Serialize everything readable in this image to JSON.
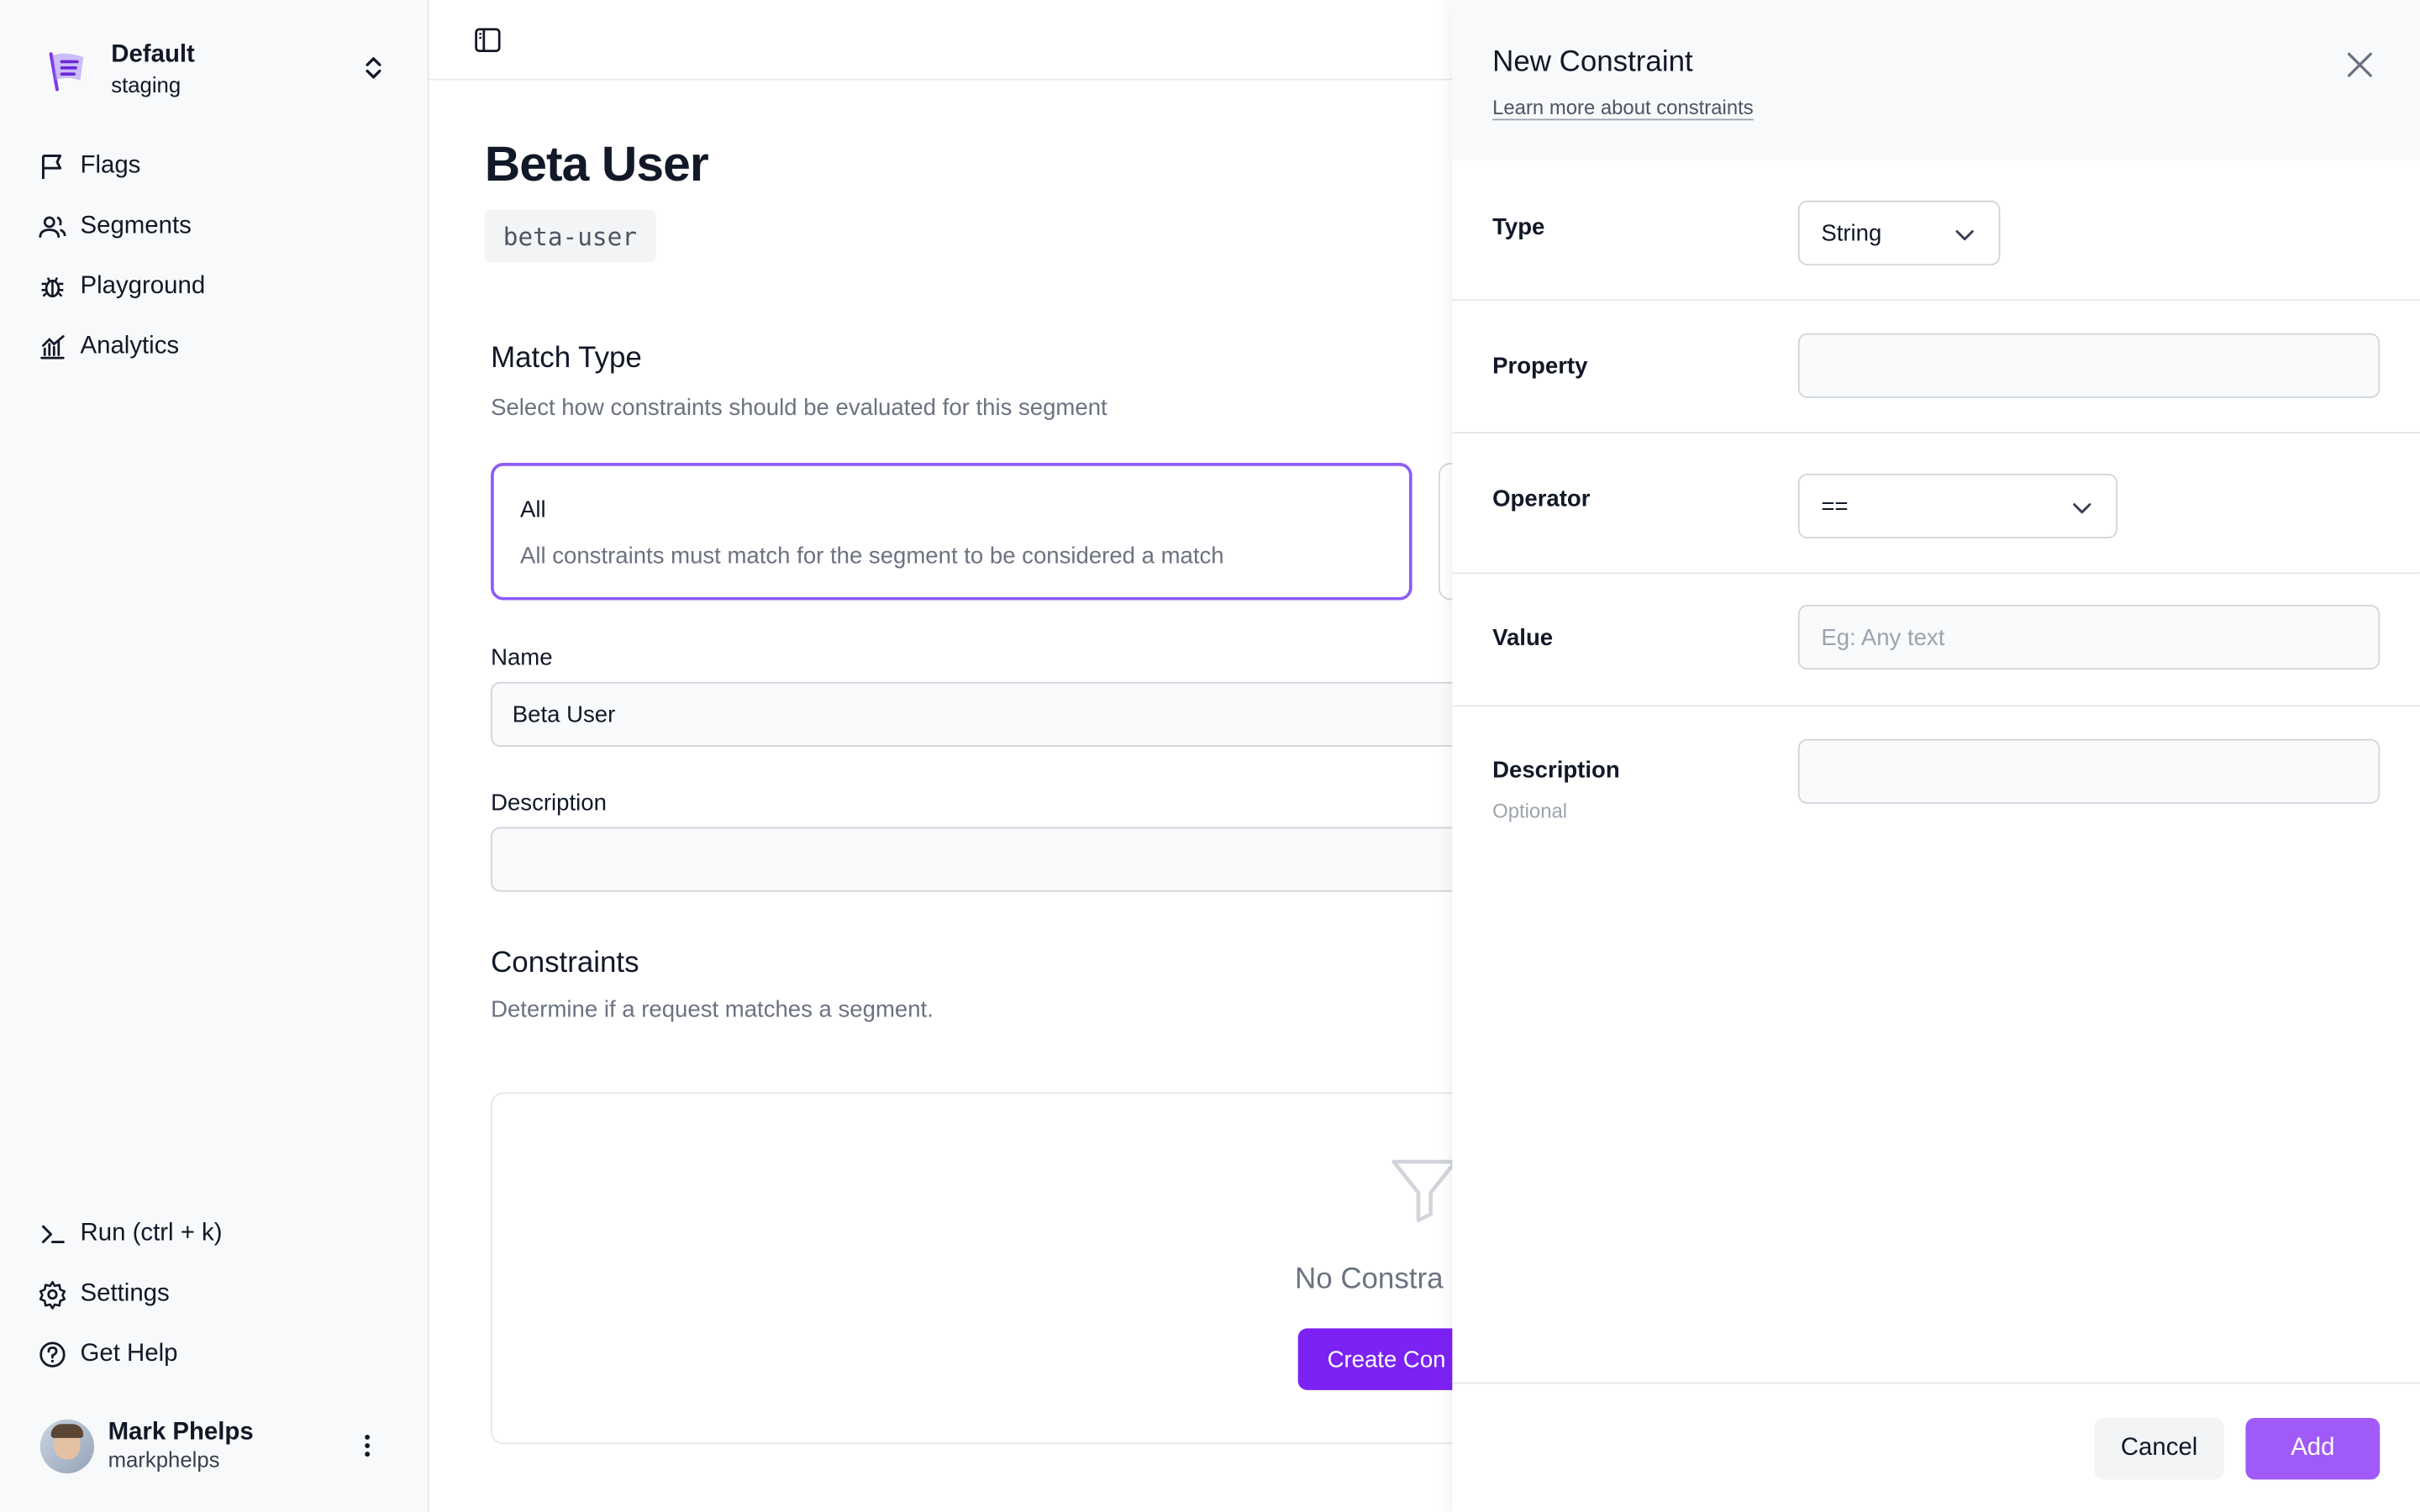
{
  "namespace": {
    "name": "Default",
    "environment": "staging"
  },
  "sidebar": {
    "items": [
      {
        "label": "Flags",
        "icon": "flag-icon"
      },
      {
        "label": "Segments",
        "icon": "users-icon"
      },
      {
        "label": "Playground",
        "icon": "bug-icon"
      },
      {
        "label": "Analytics",
        "icon": "chart-icon"
      }
    ],
    "bottom_items": [
      {
        "label": "Run (ctrl + k)",
        "icon": "terminal-icon"
      },
      {
        "label": "Settings",
        "icon": "gear-icon"
      },
      {
        "label": "Get Help",
        "icon": "help-icon"
      }
    ],
    "user": {
      "name": "Mark Phelps",
      "username": "markphelps"
    }
  },
  "segment": {
    "title": "Beta User",
    "key": "beta-user",
    "match_type": {
      "heading": "Match Type",
      "subtitle": "Select how constraints should be evaluated for this segment",
      "selected_title": "All",
      "selected_description": "All constraints must match for the segment to be considered a match"
    },
    "name_label": "Name",
    "name_value": "Beta User",
    "description_label": "Description",
    "description_value": "",
    "constraints": {
      "heading": "Constraints",
      "subtitle": "Determine if a request matches a segment.",
      "empty_text": "No Constra",
      "create_button": "Create Con"
    }
  },
  "drawer": {
    "title": "New Constraint",
    "learn_more": "Learn more about constraints",
    "type_label": "Type",
    "type_value": "String",
    "property_label": "Property",
    "property_value": "",
    "operator_label": "Operator",
    "operator_value": "==",
    "value_label": "Value",
    "value_placeholder": "Eg: Any text",
    "description_label": "Description",
    "description_hint": "Optional",
    "description_value": "",
    "cancel_label": "Cancel",
    "add_label": "Add"
  },
  "colors": {
    "accent": "#7c22f5",
    "add_button": "#a05af8",
    "selected_border": "#8b5cf6"
  }
}
